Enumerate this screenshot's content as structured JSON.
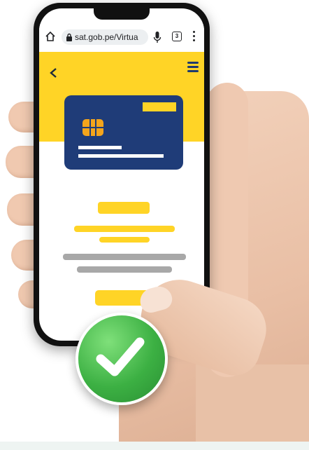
{
  "browser": {
    "url": "sat.gob.pe/Virtua",
    "tab_count": "3"
  },
  "icons": {
    "home": "home-icon",
    "lock": "lock-icon",
    "mic": "mic-icon",
    "tabs": "tabs-icon",
    "menu": "more-vert-icon",
    "back": "back-arrow-icon",
    "hamburger": "hamburger-menu-icon",
    "check": "checkmark-icon"
  },
  "colors": {
    "accent_yellow": "#ffd426",
    "card_navy": "#1f3c78",
    "chip_orange": "#f4a51c",
    "placeholder_gray": "#a8a8a8",
    "success_green": "#3cb043"
  }
}
